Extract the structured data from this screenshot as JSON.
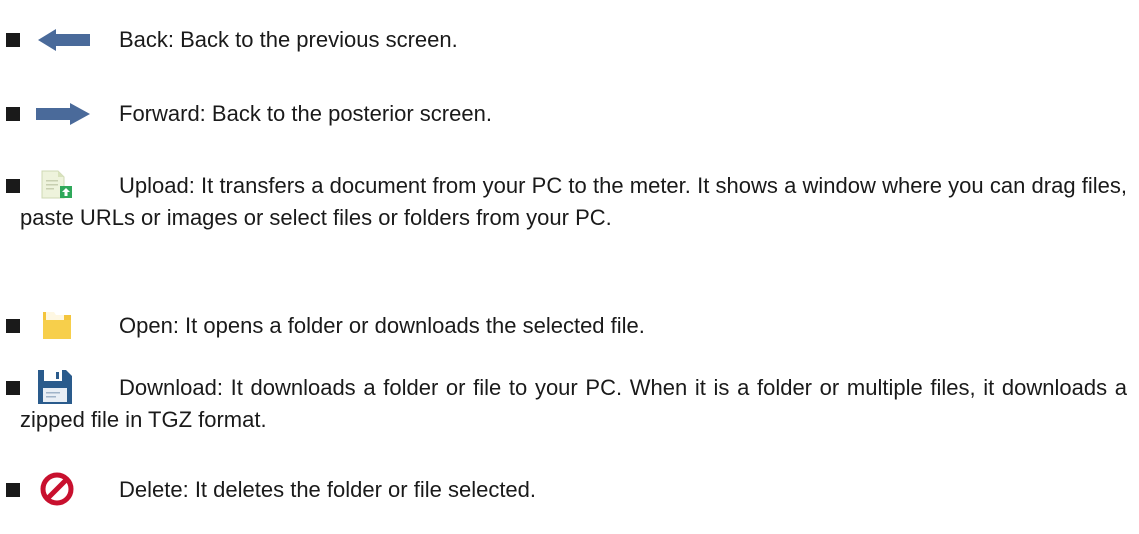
{
  "items": [
    {
      "icon": "back-arrow-icon",
      "text": "Back: Back to the previous screen."
    },
    {
      "icon": "forward-arrow-icon",
      "text": "Forward: Back to the posterior screen."
    },
    {
      "icon": "upload-document-icon",
      "text": "Upload: It transfers a document from your PC to the meter. It shows a window where you can drag files, paste URLs or images or select files or folders from your PC."
    },
    {
      "icon": "folder-icon",
      "text": "Open: It opens a folder or downloads the selected file."
    },
    {
      "icon": "floppy-disk-icon",
      "text": "Download: It downloads a folder or file to your PC. When it is a folder or multiple files, it downloads a zipped file in TGZ format."
    },
    {
      "icon": "delete-icon",
      "text": "Delete: It deletes the folder or file selected."
    }
  ],
  "colors": {
    "arrow": "#4a6a9a",
    "folder": "#f4c53d",
    "floppy": "#2a5b8c",
    "delete": "#c8102e",
    "upload_badge": "#2fa85a"
  }
}
